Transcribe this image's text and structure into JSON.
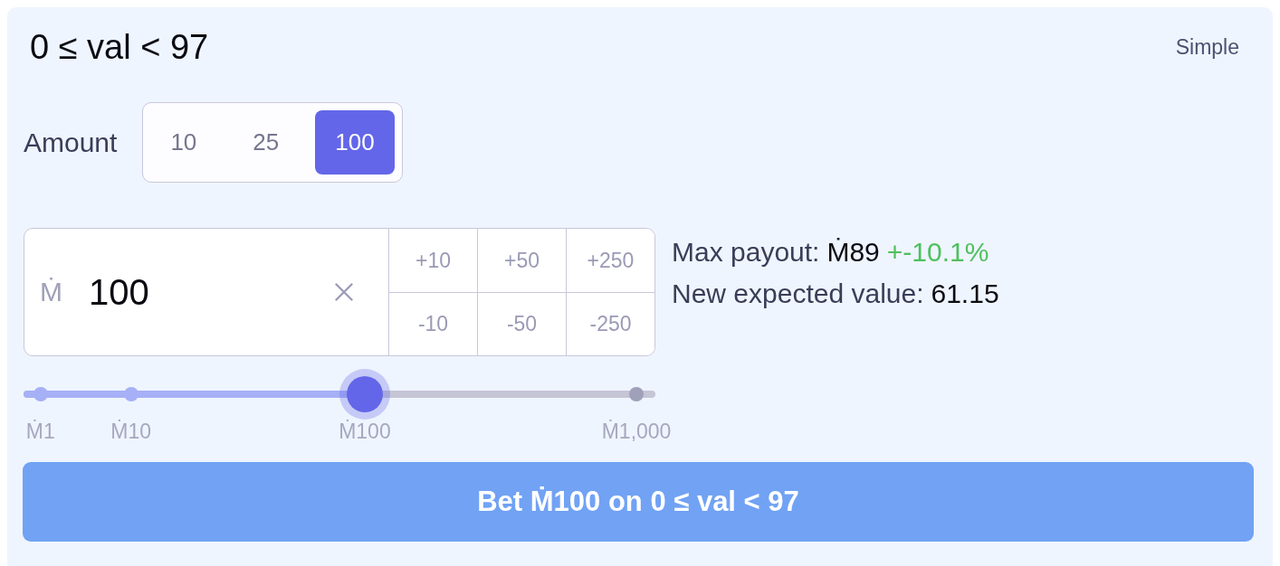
{
  "header": {
    "title": "0 ≤ val < 97",
    "mode_toggle": "Simple"
  },
  "amount": {
    "label": "Amount",
    "options": [
      {
        "label": "10",
        "selected": false
      },
      {
        "label": "25",
        "selected": false
      },
      {
        "label": "100",
        "selected": true
      }
    ]
  },
  "bet_input": {
    "currency": "Ṁ",
    "value": "100",
    "quick_adjust": [
      "+10",
      "+50",
      "+250",
      "-10",
      "-50",
      "-250"
    ]
  },
  "stats": {
    "max_payout_label": "Max payout:",
    "max_payout": "Ṁ89",
    "payout_change": "+-10.1%",
    "expected_value_label": "New expected value:",
    "expected_value": "61.15"
  },
  "slider": {
    "level": 0.54,
    "marks": [
      "Ṁ1",
      "Ṁ10",
      "Ṁ100",
      "Ṁ1,000"
    ]
  },
  "bet_button": {
    "label": "Bet Ṁ100 on 0 ≤ val < 97"
  }
}
